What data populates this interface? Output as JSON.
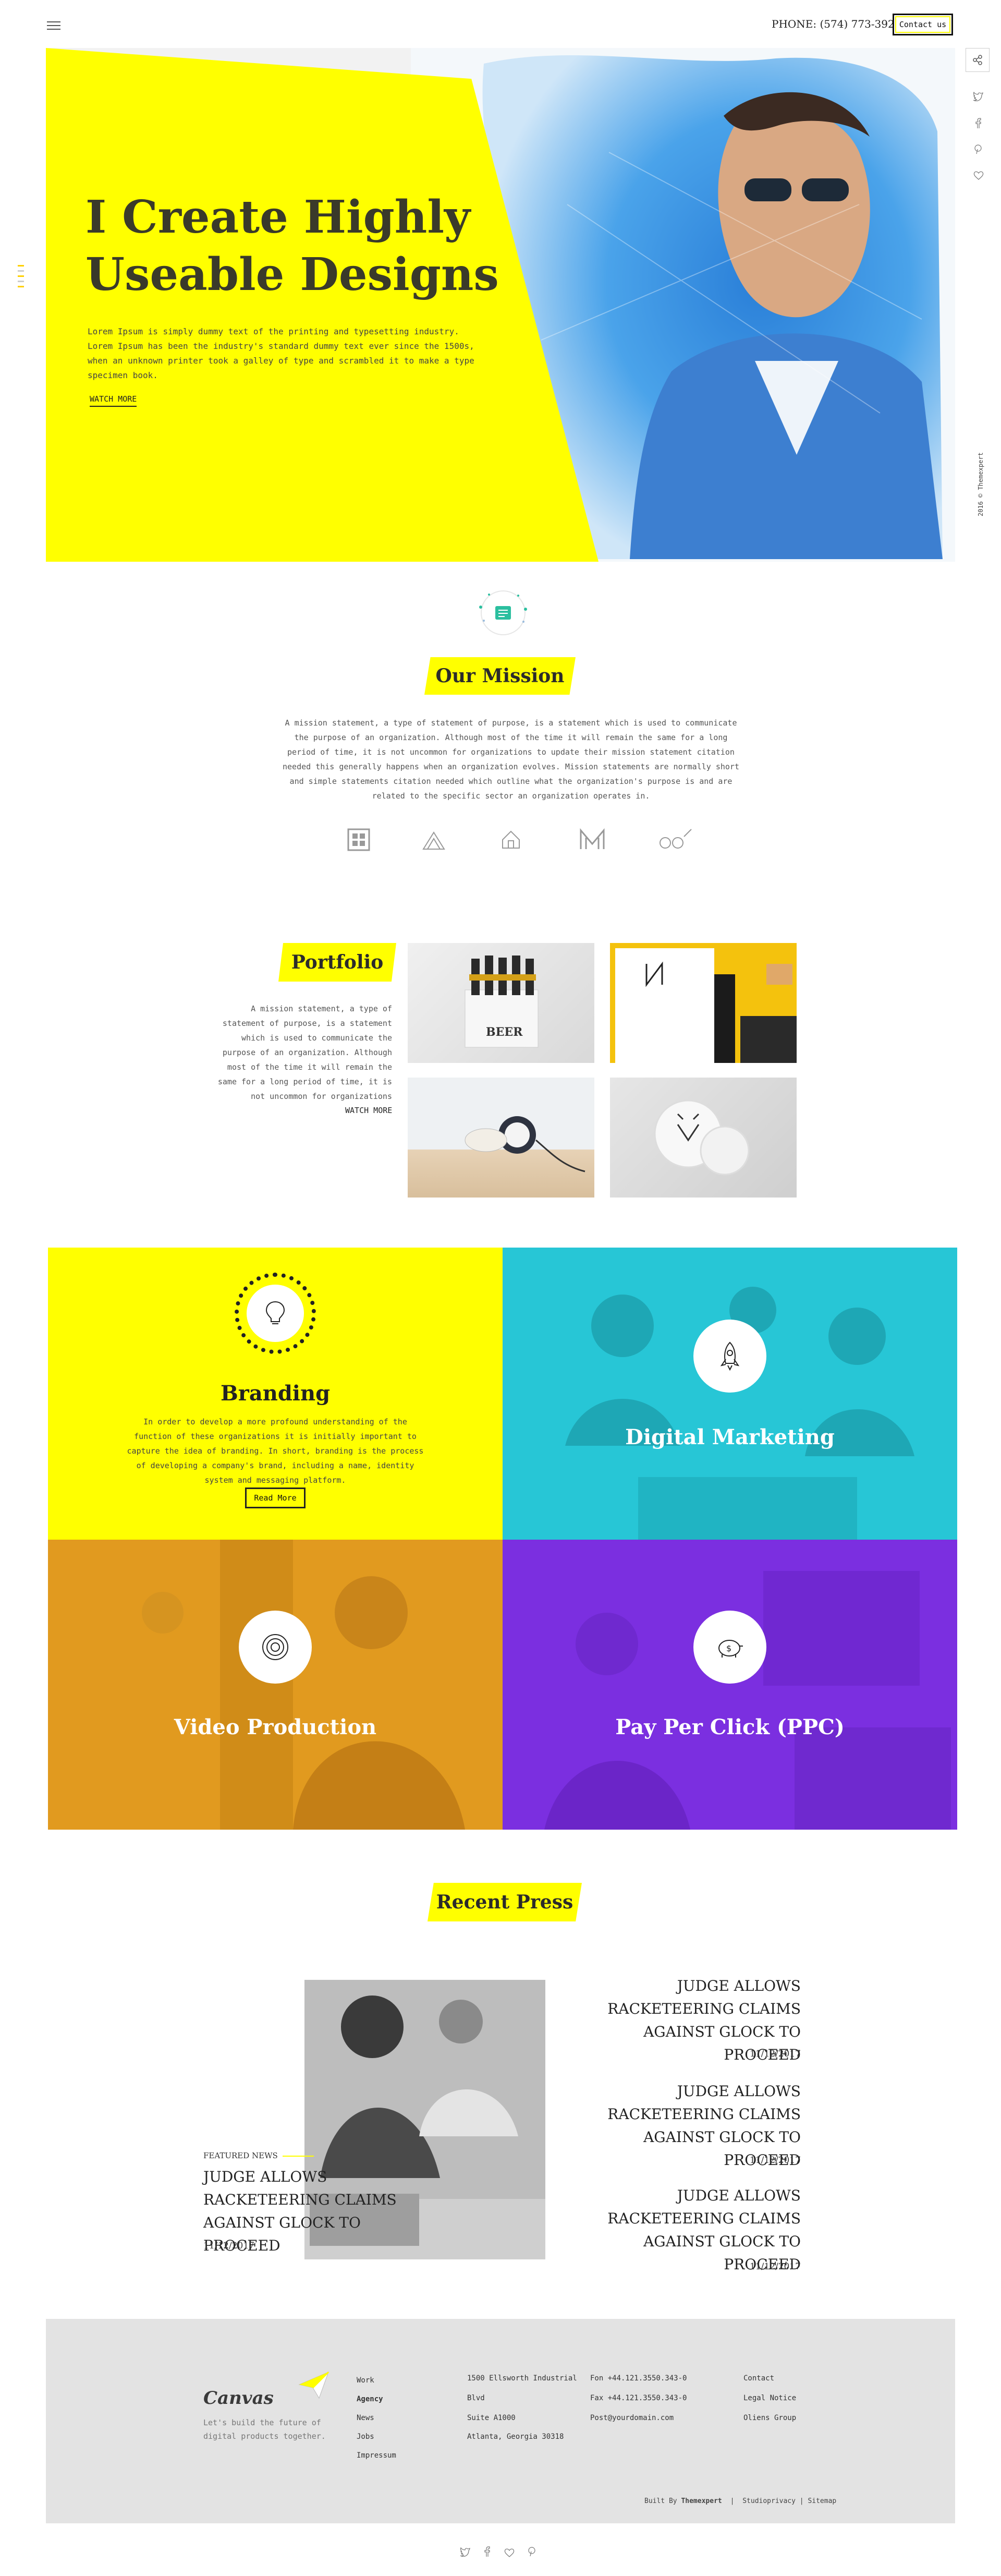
{
  "header": {
    "phone": "PHONE: (574) 773-3928",
    "contact_label": "Contact us"
  },
  "hero": {
    "title_line1": "I Create Highly",
    "title_line2": "Useable Designs",
    "text": "Lorem Ipsum is simply dummy text of the printing and typesetting industry. Lorem Ipsum has been the industry's standard dummy text ever since the 1500s, when an unknown printer took a galley of type and scrambled it to make a type specimen book.",
    "watch_label": "WATCH MORE",
    "copyright": "2016 © Themexpert"
  },
  "mission": {
    "heading": "Our Mission",
    "text": "A mission statement, a type of statement of purpose, is a statement which is used to communicate the purpose of an organization. Although most of the time it will remain the same for a long period of time, it is not uncommon for organizations to update their mission statement citation needed this generally happens when an organization evolves. Mission statements are normally short and simple statements citation needed which outline what the organization's purpose is and are related to the specific sector an organization operates in.",
    "logos": [
      "logo-grid",
      "logo-mountain",
      "logo-house",
      "logo-monogram",
      "logo-spoon"
    ]
  },
  "portfolio": {
    "heading": "Portfolio",
    "text": "A mission statement, a type of statement of purpose, is a statement which is used to communicate the purpose of an organization. Although most of the time it will remain the same for a long period of time, it is not uncommon for organizations",
    "watch_label": "WATCH MORE",
    "beer_label": "BEER"
  },
  "services": {
    "branding": {
      "title": "Branding",
      "text": "In order to develop a more profound understanding of the function of these organizations it is initially important to capture the idea of branding. In short, branding is the process of developing a company's brand, including a name, identity system and messaging platform.",
      "button": "Read More"
    },
    "digital": {
      "title": "Digital Marketing"
    },
    "video": {
      "title": "Video Production"
    },
    "ppc": {
      "title": "Pay Per Click (PPC)"
    }
  },
  "press": {
    "heading": "Recent Press",
    "featured_label": "FEATURED NEWS",
    "featured_title": "JUDGE ALLOWS RACKETEERING CLAIMS AGAINST GLOCK TO PROCEED",
    "featured_date": "11/12/2017",
    "items": [
      {
        "title": "JUDGE ALLOWS RACKETEERING CLAIMS AGAINST GLOCK TO PROCEED",
        "date": "11/12/2017"
      },
      {
        "title": "JUDGE ALLOWS RACKETEERING CLAIMS AGAINST GLOCK TO PROCEED",
        "date": "11/12/2017"
      },
      {
        "title": "JUDGE ALLOWS RACKETEERING CLAIMS AGAINST GLOCK TO PROCEED",
        "date": "11/12/2017"
      }
    ]
  },
  "footer": {
    "brand": "Canvas",
    "tagline": "Let's build the future of digital products together.",
    "nav": [
      "Work",
      "Agency",
      "News",
      "Jobs",
      "Impressum"
    ],
    "address": [
      "1500 Ellsworth Industrial",
      "Blvd",
      "Suite A1000",
      "Atlanta, Georgia 30318"
    ],
    "contact": [
      "Fon +44.121.3550.343-0",
      "Fax +44.121.3550.343-0",
      "Post@yourdomain.com"
    ],
    "links": [
      "Contact",
      "Legal Notice",
      "Oliens Group"
    ],
    "built_by_prefix": "Built By",
    "built_by_name": "Themexpert",
    "legal": "Studioprivacy | Sitemap"
  },
  "colors": {
    "accent_yellow": "#ffff00",
    "cyan": "#27c6d6",
    "orange": "#e19a1f",
    "purple": "#7b2fe0"
  }
}
